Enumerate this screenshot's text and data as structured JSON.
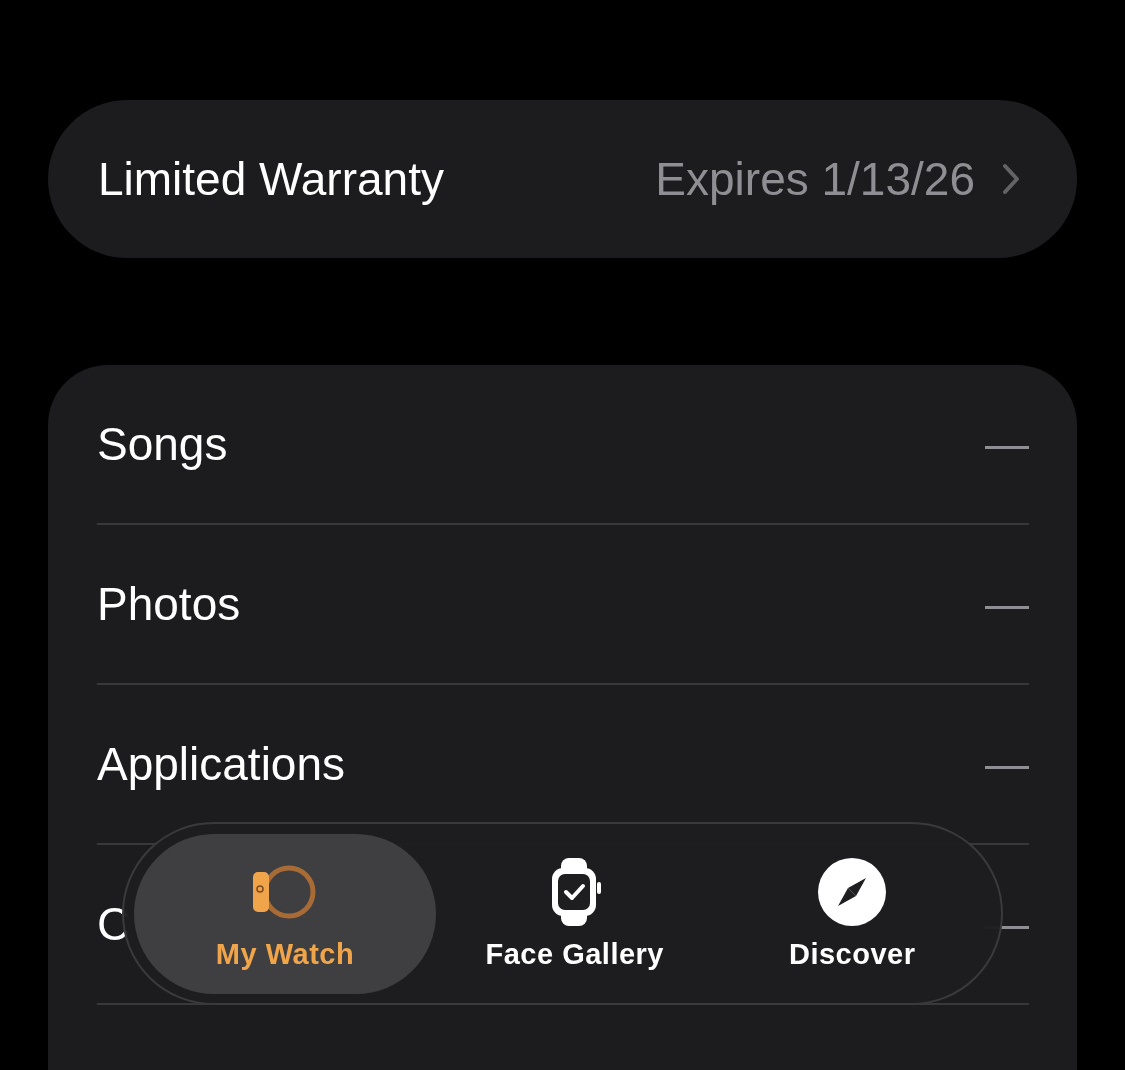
{
  "warranty": {
    "label": "Limited Warranty",
    "value": "Expires 1/13/26"
  },
  "storage_rows": [
    {
      "label": "Songs",
      "value": "—"
    },
    {
      "label": "Photos",
      "value": "—"
    },
    {
      "label": "Applications",
      "value": "—"
    },
    {
      "label": "C",
      "value": "—"
    }
  ],
  "tabs": [
    {
      "label": "My Watch",
      "selected": true,
      "kind": "watch-band"
    },
    {
      "label": "Face Gallery",
      "selected": false,
      "kind": "watch-face"
    },
    {
      "label": "Discover",
      "selected": false,
      "kind": "compass"
    }
  ]
}
